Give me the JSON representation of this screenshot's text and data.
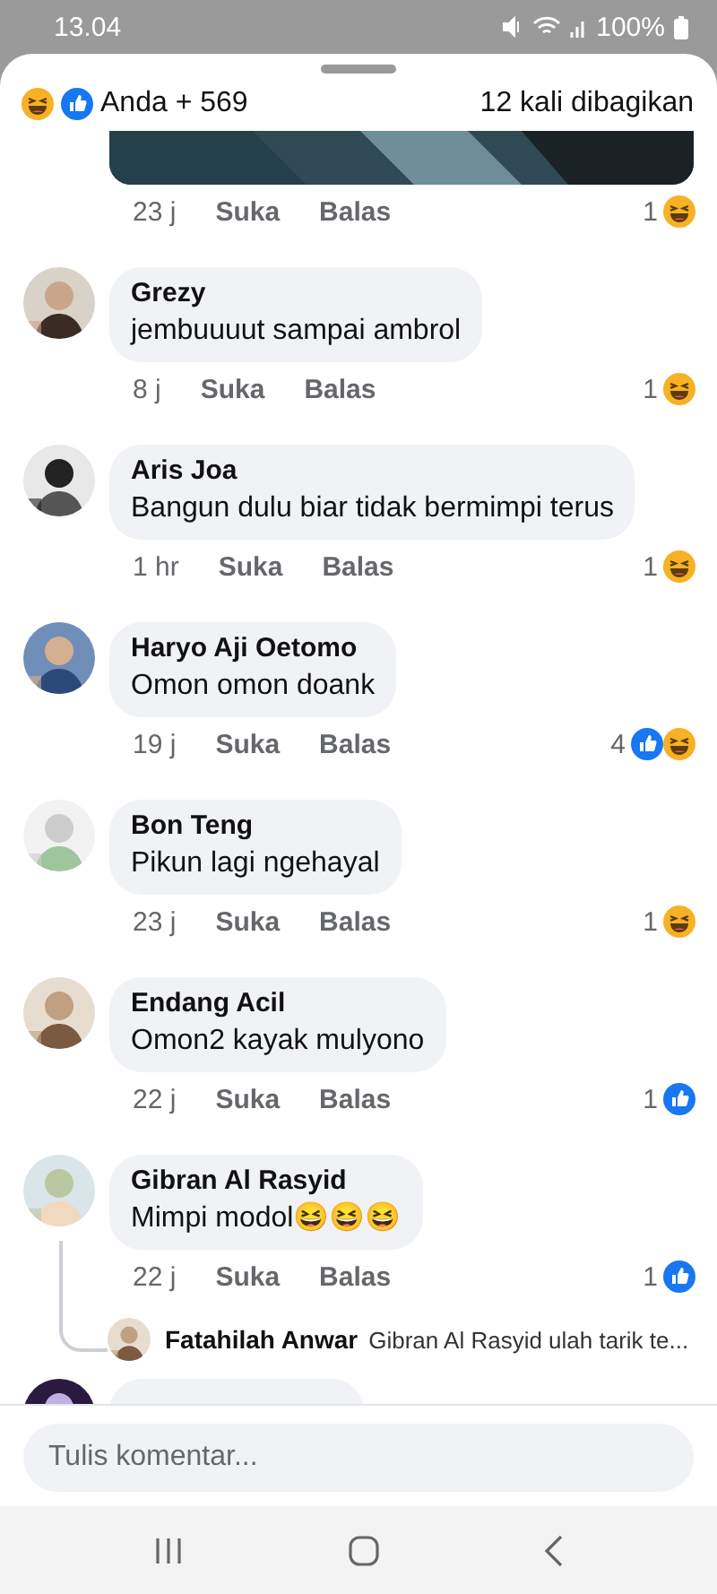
{
  "status_bar": {
    "time": "13.04",
    "battery": "100%"
  },
  "header": {
    "reactions": [
      {
        "kind": "haha"
      },
      {
        "kind": "like"
      }
    ],
    "reactors": "Anda + 569",
    "shares": "12 kali dibagikan"
  },
  "top_actions": {
    "time": "23 j",
    "like": "Suka",
    "reply": "Balas",
    "count": "1",
    "reactions": [
      {
        "kind": "haha"
      }
    ]
  },
  "comments": [
    {
      "name": "Grezy",
      "text": "jembuuuut sampai ambrol",
      "time": "8 j",
      "like": "Suka",
      "reply": "Balas",
      "count": "1",
      "reactions": [
        {
          "kind": "haha"
        }
      ]
    },
    {
      "name": "Aris Joa",
      "text": "Bangun dulu biar tidak bermimpi terus",
      "time": "1 hr",
      "like": "Suka",
      "reply": "Balas",
      "count": "1",
      "reactions": [
        {
          "kind": "haha"
        }
      ]
    },
    {
      "name": "Haryo Aji Oetomo",
      "text": "Omon omon doank",
      "time": "19 j",
      "like": "Suka",
      "reply": "Balas",
      "count": "4",
      "reactions": [
        {
          "kind": "like"
        },
        {
          "kind": "haha"
        }
      ]
    },
    {
      "name": "Bon Teng",
      "text": "Pikun lagi ngehayal",
      "time": "23 j",
      "like": "Suka",
      "reply": "Balas",
      "count": "1",
      "reactions": [
        {
          "kind": "haha"
        }
      ]
    },
    {
      "name": "Endang Acil",
      "text": "Omon2 kayak mulyono",
      "time": "22 j",
      "like": "Suka",
      "reply": "Balas",
      "count": "1",
      "reactions": [
        {
          "kind": "like"
        }
      ]
    },
    {
      "name": "Gibran Al Rasyid",
      "text": "Mimpi modol😆😆😆",
      "time": "22 j",
      "like": "Suka",
      "reply": "Balas",
      "count": "1",
      "reactions": [
        {
          "kind": "like"
        }
      ],
      "replies": [
        {
          "name": "Fatahilah Anwar",
          "text": "Gibran Al Rasyid ulah  tarik te..."
        }
      ]
    }
  ],
  "composer": {
    "placeholder": "Tulis komentar..."
  }
}
